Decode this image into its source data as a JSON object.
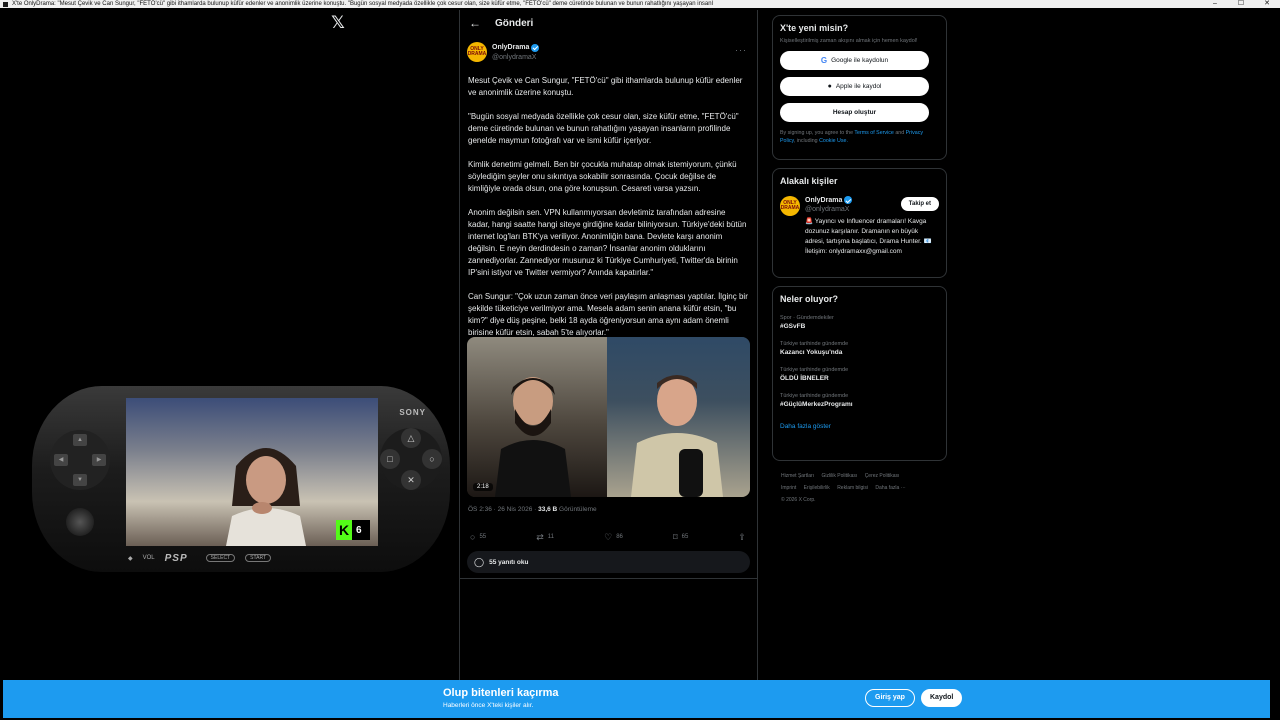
{
  "window": {
    "title": "X'te OnlyDrama: \"Mesut Çevik ve Can Sungur, \"FETÖ'cü\" gibi ithamlarda bulunup küfür edenler ve anonimlik üzerine konuştu. \"Bugün sosyal medyada özellikle çok cesur olan, size küfür etme, \"FETÖ'cü\" deme cüretinde bulunan ve bunun rahatlığını yaşayan insanl",
    "minimize": "–",
    "maximize": "☐",
    "close": "✕"
  },
  "left": {
    "logo": "𝕏"
  },
  "post_header": {
    "back": "←",
    "title": "Gönderi"
  },
  "author": {
    "avatar_text": "ONLY DRAMA",
    "name": "OnlyDrama",
    "handle": "@onlydramaX",
    "more": "···"
  },
  "tweet": {
    "paragraphs": [
      "Mesut Çevik ve Can Sungur, \"FETÖ'cü\" gibi ithamlarda bulunup küfür edenler ve anonimlik üzerine konuştu.",
      "\"Bugün sosyal medyada özellikle çok cesur olan, size küfür etme, \"FETÖ'cü\" deme cüretinde bulunan ve bunun rahatlığını yaşayan insanların profilinde genelde maymun fotoğrafı var ve ismi küfür içeriyor.",
      "Kimlik denetimi gelmeli. Ben bir çocukla muhatap olmak istemiyorum, çünkü söylediğim şeyler onu sıkıntıya sokabilir sonrasında. Çocuk değilse de kimliğiyle orada olsun, ona göre konuşsun. Cesareti varsa yazsın.",
      "Anonim değilsin sen. VPN kullanmıyorsan devletimiz tarafından adresine kadar, hangi saatte hangi siteye girdiğine kadar biliniyorsun. Türkiye'deki bütün internet log'ları BTK'ya veriliyor. Anonimliğin bana. Devlete karşı anonim değilsin. E neyin derdindesin o zaman? İnsanlar anonim olduklarını zannediyorlar. Zannediyor musunuz ki Türkiye Cumhuriyeti, Twitter'da birinin IP'sini istiyor ve Twitter vermiyor? Anında kapatırlar.\"",
      "Can Sungur: \"Çok uzun zaman önce veri paylaşım anlaşması yaptılar. İlginç bir şekilde tüketiciye verilmiyor ama. Mesela adam senin anana küfür etsin, \"bu kim?\" diye düş peşine, belki 18 ayda öğreniyorsun ama aynı adam önemli birisine küfür etsin, sabah 5'te alıyorlar.\""
    ],
    "video_duration": "2:18",
    "time": "ÖS 2:36 · 26 Nis 2026 · ",
    "views": "33,6 B",
    "views_label": " Görüntüleme",
    "replies": "55",
    "reposts": "11",
    "likes": "86",
    "bookmarks": "65",
    "read_replies": "55 yanıtı oku"
  },
  "signup_panel": {
    "title": "X'te yeni misin?",
    "subtitle": "Kişiselleştirilmiş zaman akışını almak için hemen kaydol!",
    "google": "Google ile kaydolun",
    "apple": "Apple ile kaydol",
    "create": "Hesap oluştur",
    "terms_prefix": "By signing up, you agree to the ",
    "terms_link": "Terms of Service",
    "terms_and": " and ",
    "privacy_link": "Privacy Policy",
    "terms_including": ", including ",
    "cookie_link": "Cookie Use."
  },
  "related_panel": {
    "title": "Alakalı kişiler",
    "name": "OnlyDrama",
    "handle": "@onlydramaX",
    "follow": "Takip et",
    "bio": "🚨 Yayıncı ve Influencer dramaları! Kavga dozunuz karşılanır. Dramanın en büyük adresi, tartışma başlatıcı, Drama Hunter. 📧 İletişim: onlydramaxx@gmail.com"
  },
  "trends_panel": {
    "title": "Neler oluyor?",
    "items": [
      {
        "category": "Spor · Gündemdekiler",
        "name": "#GSvFB"
      },
      {
        "category": "Türkiye tarihinde gündemde",
        "name": "Kazancı Yokuşu'nda"
      },
      {
        "category": "Türkiye tarihinde gündemde",
        "name": "ÖLDÜ İBNELER"
      },
      {
        "category": "Türkiye tarihinde gündemde",
        "name": "#GüçlüMerkezProgramı"
      }
    ],
    "show_more": "Daha fazla göster"
  },
  "footer": {
    "links": [
      "Hizmet Şartları",
      "Gizlilik Politikası",
      "Çerez Politikası",
      "Imprint",
      "Erişilebilirlik",
      "Reklam bilgisi",
      "Daha fazla ···"
    ],
    "copyright": "© 2026 X Corp."
  },
  "psp": {
    "brand": "SONY",
    "model": "PSP",
    "vol": "VOL",
    "select": "SELECT",
    "start": "START",
    "kick_letter": "K",
    "kick_count": "6"
  },
  "banner": {
    "title": "Olup bitenleri kaçırma",
    "subtitle": "Haberleri önce X'teki kişiler alır.",
    "login": "Giriş yap",
    "signup": "Kaydol"
  },
  "colors": {
    "accent": "#1d9bf0",
    "background": "#000000",
    "kick_green": "#53fc18"
  }
}
